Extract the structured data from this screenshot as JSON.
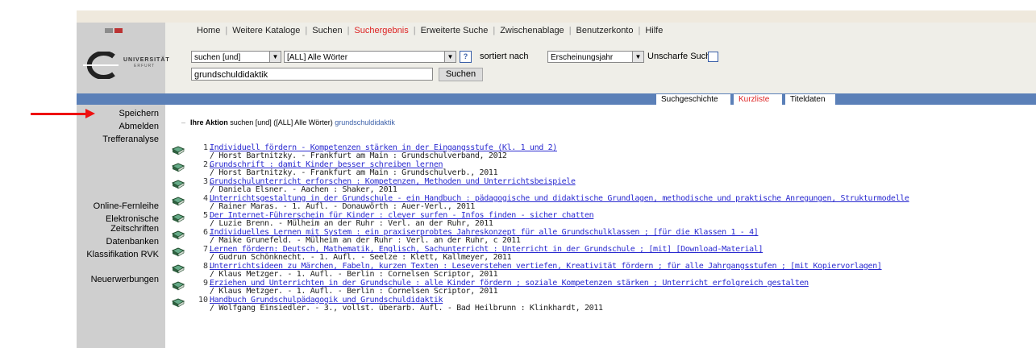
{
  "nav": {
    "items": [
      "Home",
      "Weitere Kataloge",
      "Suchen",
      "Suchergebnis",
      "Erweiterte Suche",
      "Zwischenablage",
      "Benutzerkonto",
      "Hilfe"
    ],
    "active_index": 3
  },
  "logo": {
    "line1": "UNIVERSITÄT",
    "line2": "ERFURT"
  },
  "search": {
    "operator_value": "suchen [und]",
    "field_value": "[ALL] Alle Wörter",
    "help_label": "?",
    "sorted_by_label": "sortiert nach",
    "sort_value": "Erscheinungsjahr",
    "fuzzy_label": "Unscharfe Suche",
    "query_value": "grundschuldidaktik",
    "submit_label": "Suchen"
  },
  "tabs": [
    "Suchgeschichte",
    "Kurzliste",
    "Titeldaten"
  ],
  "active_tab": "Kurzliste",
  "sidebar": {
    "items": [
      "Speichern",
      "Abmelden",
      "Trefferanalyse",
      "Online-Fernleihe",
      "Elektronische",
      "Zeitschriften",
      "Datenbanken",
      "Klassifikation RVK",
      "Neuerwerbungen"
    ]
  },
  "action": {
    "label": "Ihre Aktion",
    "text": "suchen [und] ([ALL] Alle Wörter)",
    "term": "grundschuldidaktik"
  },
  "colors": {
    "accent_red": "#dd2222",
    "link_blue": "#2a2ad0",
    "bar_blue": "#5b80b8"
  },
  "results": [
    {
      "num": "1.",
      "title": "Individuell fördern - Kompetenzen stärken in der Eingangsstufe (Kl. 1 und 2)",
      "sub": "/ Horst Bartnitzky. - Frankfurt am Main : Grundschulverband, 2012"
    },
    {
      "num": "2.",
      "title": "Grundschrift : damit Kinder besser schreiben lernen",
      "sub": "/ Horst Bartnitzky. - Frankfurt am Main : Grundschulverb., 2011"
    },
    {
      "num": "3.",
      "title": "Grundschulunterricht erforschen : Kompetenzen, Methoden und Unterrichtsbeispiele",
      "sub": "/ Daniela Elsner. - Aachen : Shaker, 2011"
    },
    {
      "num": "4.",
      "title": "Unterrichtsgestaltung in der Grundschule - ein Handbuch : pädagogische und didaktische Grundlagen, methodische und praktische Anregungen, Strukturmodelle",
      "sub": "/ Rainer Maras. - 1. Aufl. - Donauwörth : Auer-Verl., 2011"
    },
    {
      "num": "5.",
      "title": "Der Internet-Führerschein für Kinder : clever surfen - Infos finden - sicher chatten",
      "sub": "/ Luzie Brenn. - Mülheim an der Ruhr : Verl. an der Ruhr, 2011"
    },
    {
      "num": "6.",
      "title": "Individuelles Lernen mit System : ein praxiserprobtes Jahreskonzept für alle Grundschulklassen ; [für die Klassen 1 - 4]",
      "sub": "/ Maike Grunefeld. - Mülheim an der Ruhr : Verl. an der Ruhr, c 2011"
    },
    {
      "num": "7.",
      "title": "Lernen fördern: Deutsch, Mathematik, Englisch, Sachunterricht : Unterricht in der Grundschule ; [mit] [Download-Material]",
      "sub": "/ Gudrun Schönknecht. - 1. Aufl. - Seelze : Klett, Kallmeyer, 2011"
    },
    {
      "num": "8.",
      "title": "Unterrichtsideen zu Märchen, Fabeln, kurzen Texten : Leseverstehen vertiefen, Kreativität fördern ; für alle Jahrgangsstufen ; [mit Kopiervorlagen]",
      "sub": "/ Klaus Metzger. - 1. Aufl. - Berlin : Cornelsen Scriptor, 2011"
    },
    {
      "num": "9.",
      "title": "Erziehen und Unterrichten in der Grundschule : alle Kinder fördern ; soziale Kompetenzen stärken ; Unterricht erfolgreich gestalten",
      "sub": "/ Klaus Metzger. - 1. Aufl. - Berlin : Cornelsen Scriptor, 2011"
    },
    {
      "num": "10.",
      "title": "Handbuch Grundschulpädagogik und Grundschuldidaktik",
      "sub": "/ Wolfgang Einsiedler. - 3., vollst. überarb. Aufl. - Bad Heilbrunn : Klinkhardt, 2011"
    }
  ]
}
